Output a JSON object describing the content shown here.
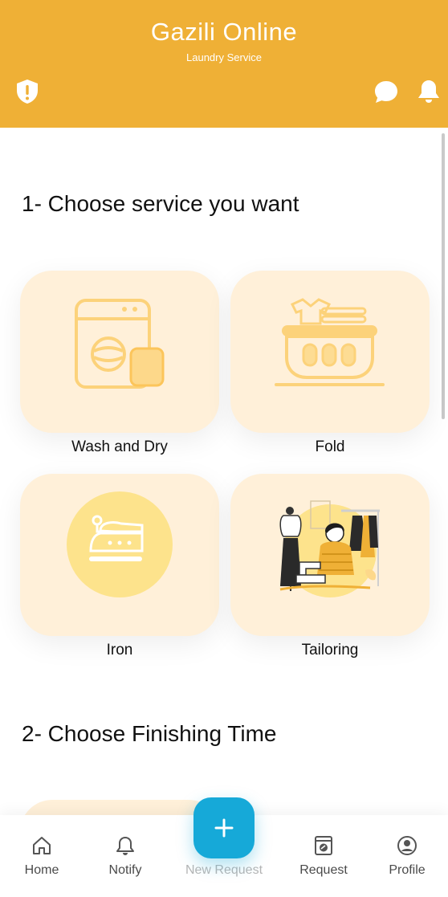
{
  "header": {
    "title": "Gazili Online",
    "subtitle": "Laundry Service",
    "left_icon": "shield-alert-icon",
    "right_icons": [
      "chat-bubble-icon",
      "bell-icon"
    ],
    "background": "#EFB036"
  },
  "sections": {
    "service_title": "1- Choose service you want",
    "time_title": "2- Choose Finishing Time"
  },
  "services": [
    {
      "label": "Wash and Dry",
      "icon": "washing-machine-icon"
    },
    {
      "label": "Fold",
      "icon": "laundry-basket-icon"
    },
    {
      "label": "Iron",
      "icon": "iron-icon"
    },
    {
      "label": "Tailoring",
      "icon": "tailoring-illustration"
    }
  ],
  "bottom_nav": {
    "items": [
      {
        "label": "Home",
        "icon": "home-icon"
      },
      {
        "label": "Notify",
        "icon": "bell-icon"
      },
      {
        "label": "New Request",
        "icon": "plus-icon"
      },
      {
        "label": "Request",
        "icon": "washing-machine-icon"
      },
      {
        "label": "Profile",
        "icon": "user-circle-icon"
      }
    ],
    "fab_color": "#16A9D8"
  },
  "colors": {
    "accent": "#EFB036",
    "card_bg": "#FFF0D9",
    "fab": "#16A9D8"
  }
}
